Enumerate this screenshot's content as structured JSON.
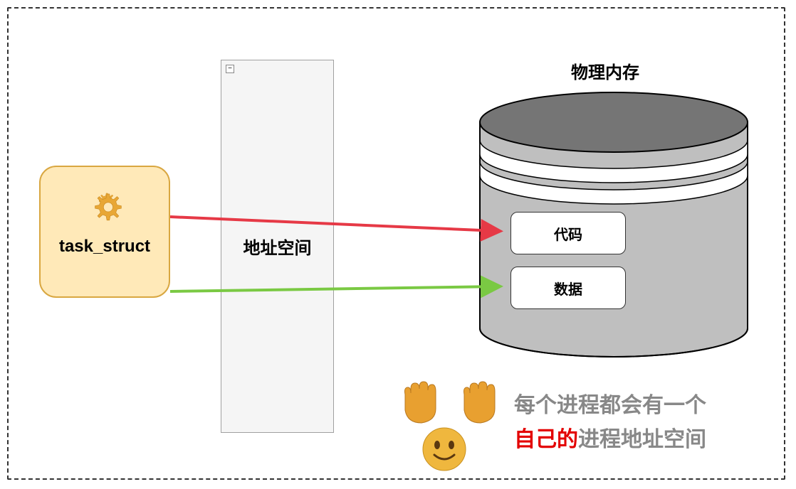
{
  "task_struct": {
    "label": "task_struct"
  },
  "address_space": {
    "label": "地址空间"
  },
  "physical_memory": {
    "label": "物理内存",
    "code_label": "代码",
    "data_label": "数据"
  },
  "bottom_text": {
    "line1": "每个进程都会有一个",
    "line2_red": "自己的",
    "line2_gray": "进程地址空间"
  },
  "icons": {
    "gear": "gear-icon",
    "collapse": "collapse-icon",
    "hand_left": "raised-hand-icon",
    "hand_right": "raised-hand-icon",
    "face": "smiley-face-icon"
  },
  "colors": {
    "task_struct_bg": "#FFE9B8",
    "task_struct_border": "#D9A741",
    "arrow_red": "#E63946",
    "arrow_green": "#7AC943",
    "cylinder_top": "#808080",
    "cylinder_body": "#BFBFBF"
  }
}
